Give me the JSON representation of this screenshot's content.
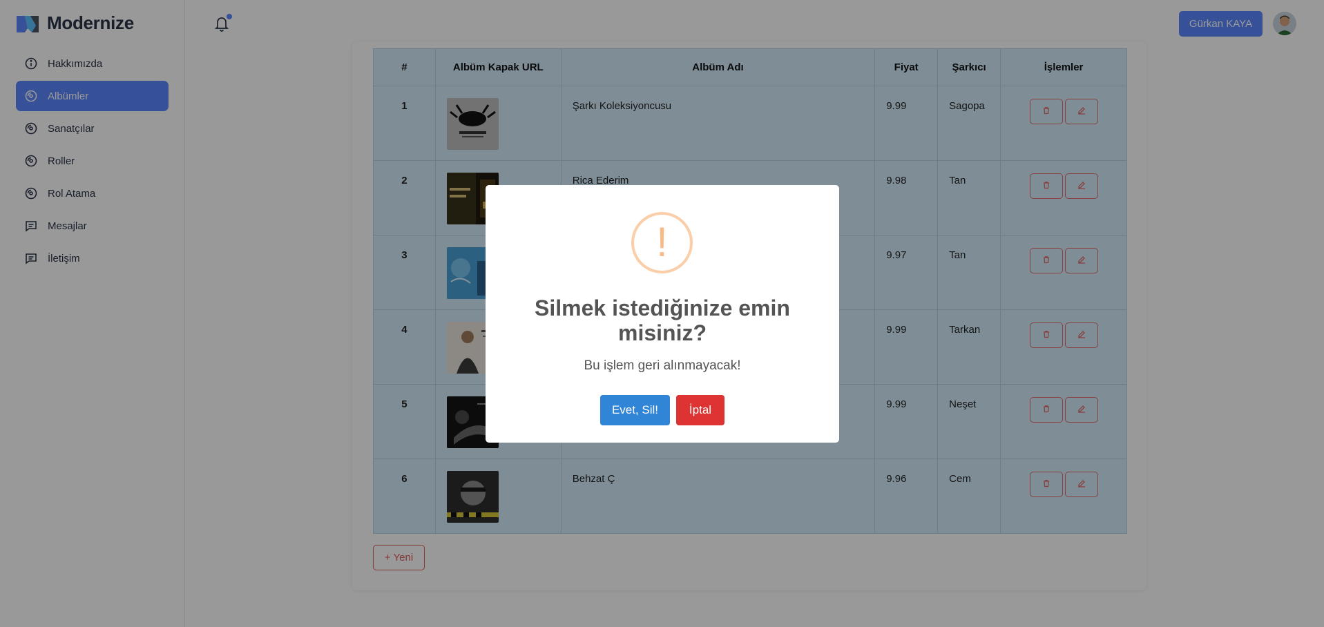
{
  "brand": {
    "name": "Modernize"
  },
  "sidebar": {
    "items": [
      {
        "label": "Hakkımızda",
        "icon": "info-circle-icon"
      },
      {
        "label": "Albümler",
        "icon": "disc-icon",
        "active": true
      },
      {
        "label": "Sanatçılar",
        "icon": "disc-icon"
      },
      {
        "label": "Roller",
        "icon": "disc-icon"
      },
      {
        "label": "Rol Atama",
        "icon": "disc-icon"
      },
      {
        "label": "Mesajlar",
        "icon": "message-icon"
      },
      {
        "label": "İletişim",
        "icon": "message-icon"
      }
    ]
  },
  "header": {
    "user_label": "Gürkan KAYA",
    "notification_icon": "bell-icon"
  },
  "table": {
    "columns": [
      "#",
      "Albüm Kapak URL",
      "Albüm Adı",
      "Fiyat",
      "Şarkıcı",
      "İşlemler"
    ],
    "rows": [
      {
        "idx": "1",
        "name": "Şarkı Koleksiyoncusu",
        "price": "9.99",
        "artist": "Sagopa"
      },
      {
        "idx": "2",
        "name": "Rica Ederim",
        "price": "9.98",
        "artist": "Tan"
      },
      {
        "idx": "3",
        "name": "",
        "price": "9.97",
        "artist": "Tan"
      },
      {
        "idx": "4",
        "name": "",
        "price": "9.99",
        "artist": "Tarkan"
      },
      {
        "idx": "5",
        "name": "",
        "price": "9.99",
        "artist": "Neşet"
      },
      {
        "idx": "6",
        "name": "Behzat Ç",
        "price": "9.96",
        "artist": "Cem"
      }
    ]
  },
  "new_button": "+ Yeni",
  "dialog": {
    "icon": "!",
    "title": "Silmek istediğinize emin misiniz?",
    "text": "Bu işlem geri alınmayacak!",
    "confirm": "Evet, Sil!",
    "cancel": "İptal"
  },
  "colors": {
    "primary": "#5d87ff",
    "table_bg": "#d2ecfa",
    "danger": "#dd3333",
    "confirm": "#3085d6",
    "warning": "#f8bb86"
  }
}
